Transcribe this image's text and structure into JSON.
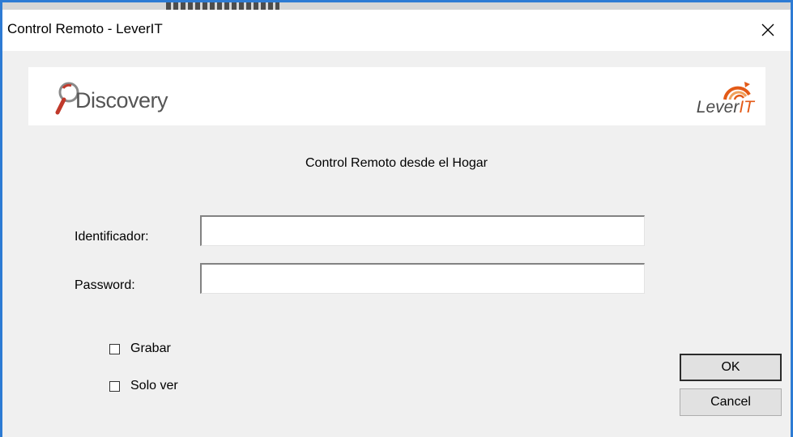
{
  "window": {
    "title": "Control Remoto - LeverIT",
    "close_symbol": "×"
  },
  "banner": {
    "left_logo": "Discovery",
    "right_logo_main": "Lever",
    "right_logo_accent": "IT"
  },
  "heading": "Control Remoto desde el Hogar",
  "form": {
    "id_label": "Identificador:",
    "id_value": "",
    "password_label": "Password:",
    "password_value": ""
  },
  "options": [
    {
      "label": "Grabar",
      "checked": false
    },
    {
      "label": "Solo ver",
      "checked": false
    }
  ],
  "buttons": {
    "ok": "OK",
    "cancel": "Cancel"
  },
  "colors": {
    "window_border": "#2d7bd4",
    "brand_orange": "#e35a17",
    "logo_red": "#c0392b"
  }
}
